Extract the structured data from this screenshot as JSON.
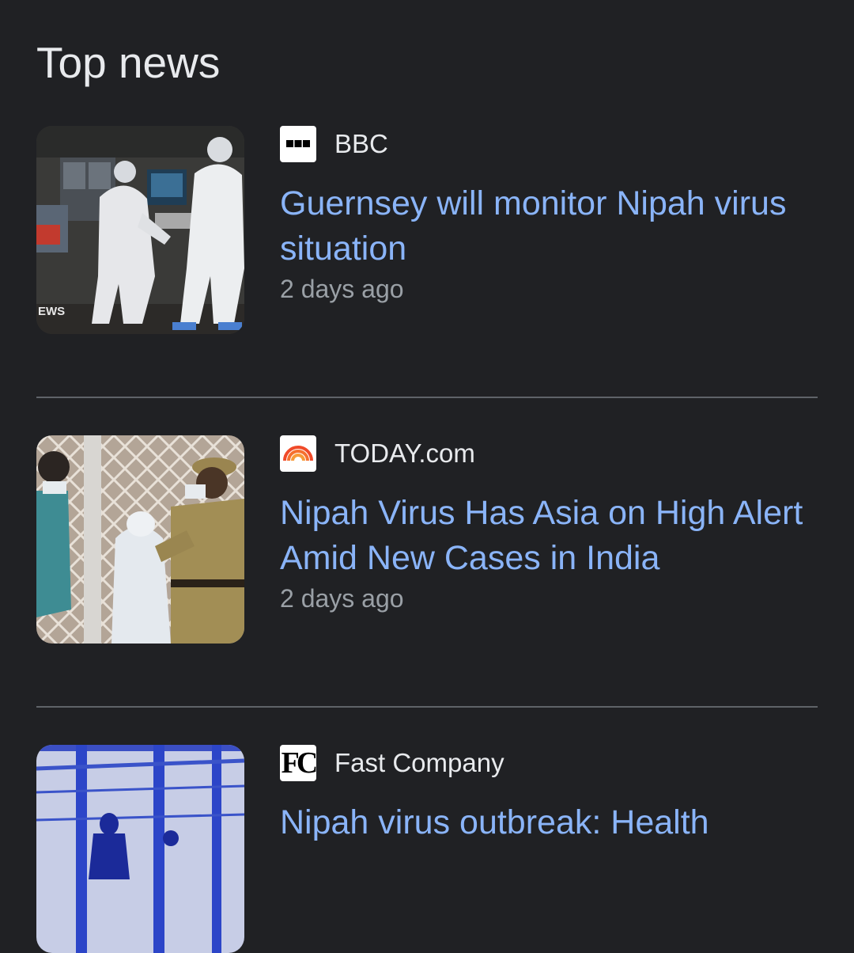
{
  "section": {
    "title": "Top news"
  },
  "stories": [
    {
      "source": "BBC",
      "source_icon": "bbc-logo-icon",
      "headline": "Guernsey will monitor Nipah virus situation",
      "time": "2 days ago",
      "thumbnail": "health-workers-in-protective-suits-photo",
      "thumbnail_caption": "EWS"
    },
    {
      "source": "TODAY.com",
      "source_icon": "today-logo-icon",
      "headline": "Nipah Virus Has Asia on High Alert Amid New Cases in India",
      "time": "2 days ago",
      "thumbnail": "police-officer-and-health-worker-photo"
    },
    {
      "source": "Fast Company",
      "source_icon": "fast-company-logo-icon",
      "source_logo_text": "FC",
      "headline": "Nipah virus outbreak: Health",
      "thumbnail": "blue-tinted-fence-photo"
    }
  ],
  "colors": {
    "background": "#202124",
    "headline": "#8ab4f8",
    "secondary_text": "#9aa0a6",
    "primary_text": "#e8eaed",
    "divider": "#5f6368"
  }
}
